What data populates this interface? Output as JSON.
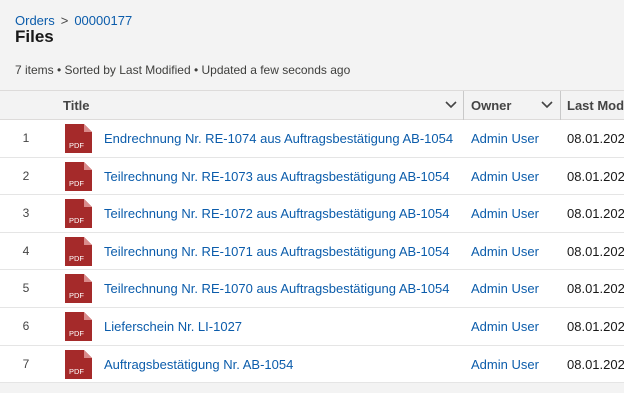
{
  "breadcrumb": {
    "parent": "Orders",
    "separator": ">",
    "record": "00000177"
  },
  "page": {
    "title": "Files",
    "subtitle": "7 items • Sorted by Last Modified • Updated a few seconds ago"
  },
  "table": {
    "columns": {
      "title": "Title",
      "owner": "Owner",
      "modified": "Last Modi"
    },
    "rows": [
      {
        "num": "1",
        "icon": "pdf-icon",
        "icon_label": "PDF",
        "title": "Endrechnung Nr. RE-1074 aus Auftragsbestätigung AB-1054",
        "owner": "Admin User",
        "modified": "08.01.202"
      },
      {
        "num": "2",
        "icon": "pdf-icon",
        "icon_label": "PDF",
        "title": "Teilrechnung Nr. RE-1073 aus Auftragsbestätigung AB-1054",
        "owner": "Admin User",
        "modified": "08.01.202"
      },
      {
        "num": "3",
        "icon": "pdf-icon",
        "icon_label": "PDF",
        "title": "Teilrechnung Nr. RE-1072 aus Auftragsbestätigung AB-1054",
        "owner": "Admin User",
        "modified": "08.01.202"
      },
      {
        "num": "4",
        "icon": "pdf-icon",
        "icon_label": "PDF",
        "title": "Teilrechnung Nr. RE-1071 aus Auftragsbestätigung AB-1054",
        "owner": "Admin User",
        "modified": "08.01.202"
      },
      {
        "num": "5",
        "icon": "pdf-icon",
        "icon_label": "PDF",
        "title": "Teilrechnung Nr. RE-1070 aus Auftragsbestätigung AB-1054",
        "owner": "Admin User",
        "modified": "08.01.202"
      },
      {
        "num": "6",
        "icon": "pdf-icon",
        "icon_label": "PDF",
        "title": "Lieferschein Nr. LI-1027",
        "owner": "Admin User",
        "modified": "08.01.202"
      },
      {
        "num": "7",
        "icon": "pdf-icon",
        "icon_label": "PDF",
        "title": "Auftragsbestätigung Nr. AB-1054",
        "owner": "Admin User",
        "modified": "08.01.202"
      }
    ]
  },
  "colors": {
    "link": "#0b5cab",
    "pdf_icon": "#a52a2a",
    "header_bg": "#f3f3f3"
  }
}
